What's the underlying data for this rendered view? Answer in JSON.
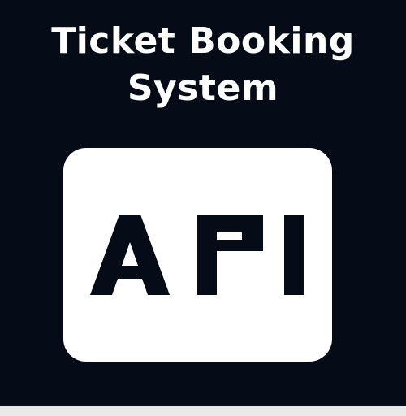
{
  "header": {
    "title_line1": "Ticket Booking",
    "title_line2": "System"
  },
  "api_icon": {
    "label": "API",
    "icon_name": "api-icon",
    "tile_color": "#ffffff",
    "glyph_color": "#050c17"
  },
  "colors": {
    "background": "#050c17",
    "text": "#ffffff",
    "bottom_strip": "#e9e9e9"
  }
}
